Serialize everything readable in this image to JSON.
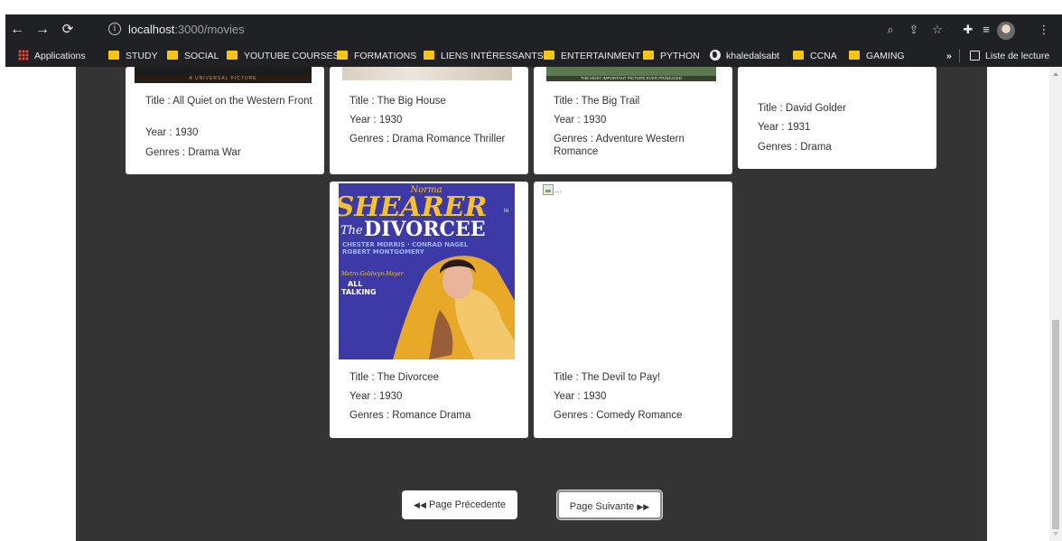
{
  "browser": {
    "url_host": "localhost",
    "url_path": ":3000/movies",
    "bookmarks": [
      {
        "label": "Applications",
        "icon": "apps-grid-icon"
      },
      {
        "label": "STUDY",
        "icon": "folder-icon"
      },
      {
        "label": "SOCIAL",
        "icon": "folder-icon"
      },
      {
        "label": "YOUTUBE COURSES",
        "icon": "folder-icon"
      },
      {
        "label": "FORMATIONS",
        "icon": "folder-icon"
      },
      {
        "label": "LIENS INTÉRESSANTS",
        "icon": "folder-icon"
      },
      {
        "label": "ENTERTAINMENT",
        "icon": "folder-icon"
      },
      {
        "label": "PYTHON",
        "icon": "folder-icon"
      },
      {
        "label": "khaledalsabt",
        "icon": "globe-icon"
      },
      {
        "label": "CCNA",
        "icon": "folder-icon"
      },
      {
        "label": "GAMING",
        "icon": "folder-icon"
      }
    ],
    "overflow_label": "»",
    "reading_list_label": "Liste de lecture"
  },
  "movies": [
    {
      "title": "Title : All Quiet on the Western Front",
      "year": "Year : 1930",
      "genres": "Genres : Drama War"
    },
    {
      "title": "Title : The Big House",
      "year": "Year : 1930",
      "genres": "Genres : Drama Romance Thriller"
    },
    {
      "title": "Title : The Big Trail",
      "year": "Year : 1930",
      "genres": "Genres : Adventure Western Romance"
    },
    {
      "title": "Title : David Golder",
      "year": "Year : 1931",
      "genres": "Genres : Drama"
    },
    {
      "title": "Title : The Divorcee",
      "year": "Year : 1930",
      "genres": "Genres : Romance Drama"
    },
    {
      "title": "Title : The Devil to Pay!",
      "year": "Year : 1930",
      "genres": "Genres : Comedy Romance"
    }
  ],
  "posters": {
    "all_quiet_caption": "A UNIVERSAL PICTURE",
    "big_trail_caption": "THE MOST IMPORTANT PICTURE EVER PRODUCED",
    "divorcee": {
      "top": "Norma",
      "name": "SHEARER",
      "in": "in",
      "the": "The",
      "title": "DIVORCEE",
      "cast1": "CHESTER MORRIS · CONRAD NAGEL",
      "cast2": "ROBERT MONTGOMERY",
      "studio": "Metro-Goldwyn-Mayer",
      "talking1": "ALL",
      "talking2": "TALKING"
    },
    "broken_alt": "..."
  },
  "pagination": {
    "prev_label": "Page Précedente",
    "next_label": "Page Suivante"
  },
  "colors": {
    "content_bg": "#343434",
    "browser_bg": "#202124",
    "folder": "#f5c518"
  }
}
